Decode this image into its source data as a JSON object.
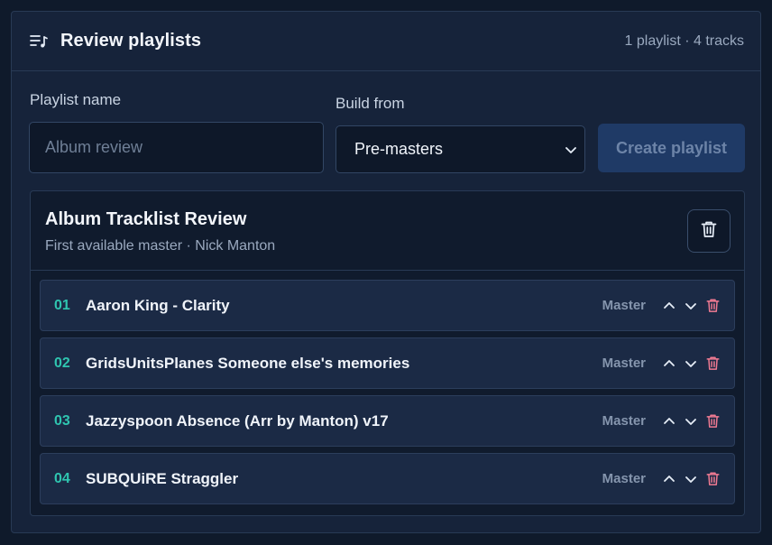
{
  "header": {
    "title": "Review playlists",
    "meta": "1 playlist · 4 tracks",
    "icon": "playlist-music-icon"
  },
  "form": {
    "name_label": "Playlist name",
    "name_placeholder": "Album review",
    "name_value": "",
    "build_label": "Build from",
    "build_value": "Pre-masters",
    "create_label": "Create playlist"
  },
  "playlist": {
    "title": "Album Tracklist Review",
    "subtitle": "First available master · Nick Manton",
    "tracks": [
      {
        "num": "01",
        "title": "Aaron King - Clarity",
        "badge": "Master"
      },
      {
        "num": "02",
        "title": "GridsUnitsPlanes Someone else's memories",
        "badge": "Master"
      },
      {
        "num": "03",
        "title": "Jazzyspoon Absence (Arr by Manton) v17",
        "badge": "Master"
      },
      {
        "num": "04",
        "title": "SUBQUiRE Straggler",
        "badge": "Master"
      }
    ]
  },
  "colors": {
    "accent_teal": "#2fc5b0",
    "danger": "#f07a92",
    "button_disabled": "#1f3a66"
  }
}
